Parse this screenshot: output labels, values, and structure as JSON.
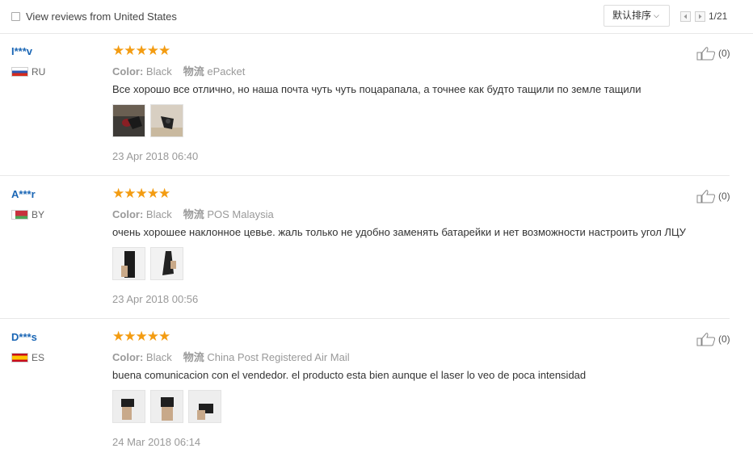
{
  "filter": {
    "checkbox_label": "View reviews from United States"
  },
  "sort": {
    "label": "默认排序"
  },
  "pagination": {
    "text": "1/21"
  },
  "reviews": [
    {
      "user": "I***v",
      "country": "RU",
      "flag": "ru",
      "rating": 5,
      "stars": "★★★★★",
      "color_key": "Color:",
      "color_value": "Black",
      "shipping_key": "物流",
      "shipping_value": "ePacket",
      "text": "Все хорошо все отлично, но наша почта чуть чуть поцарапала, а точнее как будто тащили по земле тащили",
      "photos": 2,
      "date": "23 Apr 2018 06:40",
      "likes": "(0)"
    },
    {
      "user": "A***r",
      "country": "BY",
      "flag": "by",
      "rating": 5,
      "stars": "★★★★★",
      "color_key": "Color:",
      "color_value": "Black",
      "shipping_key": "物流",
      "shipping_value": "POS Malaysia",
      "text": "очень хорошее наклонное цевье. жаль только не удобно заменять батарейки и нет возможности настроить угол ЛЦУ",
      "photos": 2,
      "date": "23 Apr 2018 00:56",
      "likes": "(0)"
    },
    {
      "user": "D***s",
      "country": "ES",
      "flag": "es",
      "rating": 5,
      "stars": "★★★★★",
      "color_key": "Color:",
      "color_value": "Black",
      "shipping_key": "物流",
      "shipping_value": "China Post Registered Air Mail",
      "text": "buena comunicacion con el vendedor. el producto esta bien aunque el laser lo veo de poca intensidad",
      "photos": 3,
      "date": "24 Mar 2018 06:14",
      "likes": "(0)"
    }
  ],
  "colors": {
    "star": "#f39c12",
    "username": "#1a66b5",
    "muted": "#999999"
  }
}
